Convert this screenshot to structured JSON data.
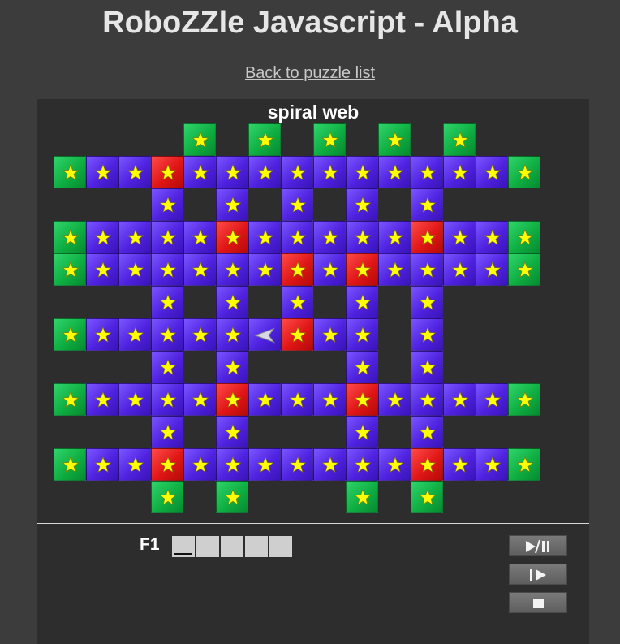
{
  "header": {
    "title": "RoboZZle Javascript - Alpha",
    "back_link": "Back to puzzle list"
  },
  "puzzle": {
    "name": "spiral web",
    "colors": {
      "blue": "#5a2cf0",
      "red": "#e81a1a",
      "green": "#10b045",
      "star": "#ffff00"
    },
    "robot": {
      "row": 6,
      "col": 6,
      "facing": "left"
    },
    "grid": [
      "....G.G.G.G.G..",
      "GBBRBBBBBBBBBBG",
      "...B.B.B.B.B...",
      "GBBBBRBBBBBRBBG",
      "GBBBBBBRBRBBBBG",
      "...B.B.B.B.B...",
      "GBBBBBBRBB.B...",
      "...B.B...B.B...",
      "GBBBBRBBBRBBBBG",
      "...B.B...B.B...",
      "GBBRBBBBBBBRBBG",
      "...G.G...G.G..."
    ],
    "stars": [
      "....*.*.*.*.*..",
      "***************",
      "...*.*.*.*.*...",
      "***************",
      "***************",
      "...*.*.*.*.*...",
      "******.***.*...",
      "...*.*...*.*...",
      "***************",
      "...*.*...*.*...",
      "***************",
      "...*.*...*.*..."
    ]
  },
  "program": {
    "function_label": "F1",
    "slot_count": 5
  },
  "controls": [
    {
      "name": "play-pause-button",
      "icon": "play-pause-icon"
    },
    {
      "name": "step-button",
      "icon": "step-icon"
    },
    {
      "name": "stop-button",
      "icon": "stop-icon"
    }
  ]
}
